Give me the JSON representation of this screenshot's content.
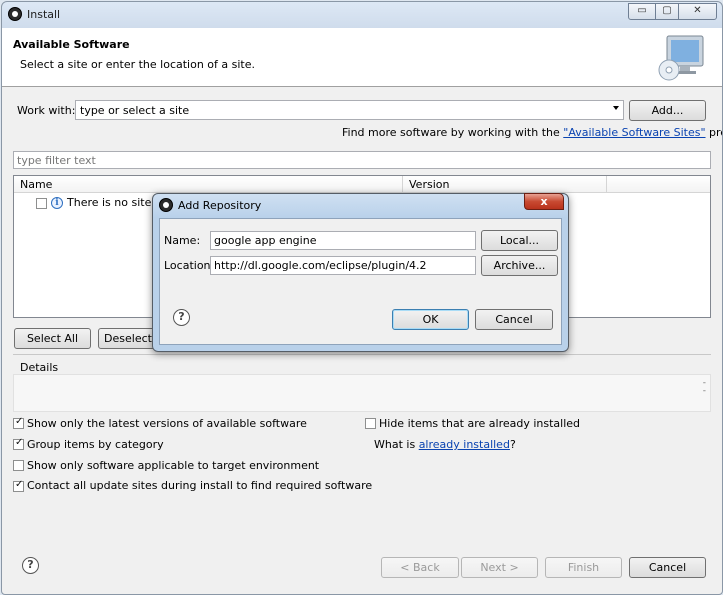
{
  "window": {
    "title": "Install"
  },
  "header": {
    "title": "Available Software",
    "subtitle": "Select a site or enter the location of a site."
  },
  "work_with": {
    "label": "Work with:",
    "value": "type or select a site",
    "add_label": "Add..."
  },
  "find_more": {
    "prefix": "Find more software by working with the ",
    "link": "\"Available Software Sites\"",
    "suffix": " preferences."
  },
  "filter": {
    "placeholder": "type filter text"
  },
  "table": {
    "columns": [
      "Name",
      "Version"
    ],
    "rows": [
      {
        "text": "There is no site sel"
      }
    ]
  },
  "buttons": {
    "select_all": "Select All",
    "deselect": "Deselect A"
  },
  "details": {
    "label": "Details"
  },
  "options": {
    "left": [
      {
        "label": "Show only the latest versions of available software",
        "checked": true
      },
      {
        "label": "Group items by category",
        "checked": true
      },
      {
        "label": "Show only software applicable to target environment",
        "checked": false
      },
      {
        "label": "Contact all update sites during install to find required software",
        "checked": true
      }
    ],
    "hide_installed": {
      "label": "Hide items that are already installed",
      "checked": false
    },
    "what_is": {
      "prefix": "What is ",
      "link": "already installed",
      "suffix": "?"
    }
  },
  "footer": {
    "back": "< Back",
    "next": "Next >",
    "finish": "Finish",
    "cancel": "Cancel"
  },
  "dialog": {
    "title": "Add Repository",
    "close": "x",
    "name_label": "Name:",
    "name_value": "google app engine",
    "local_label": "Local...",
    "location_label": "Location:",
    "location_value": "http://dl.google.com/eclipse/plugin/4.2",
    "archive_label": "Archive...",
    "ok_label": "OK",
    "cancel_label": "Cancel"
  },
  "colors": {
    "link": "#0a43b1",
    "close_button": "#c84a32"
  },
  "icons": {
    "window": "eclipse-icon",
    "header": "monitor-cd-icon",
    "help": "help-icon",
    "info": "info-icon"
  }
}
